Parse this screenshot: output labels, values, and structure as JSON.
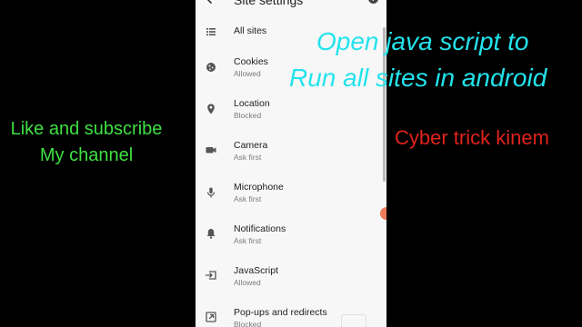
{
  "overlay": {
    "title_line1": "Open java script to",
    "title_line2": "Run all sites in android",
    "left_line1": "Like and subscribe",
    "left_line2": "My channel",
    "right_text": "Cyber trick kinem"
  },
  "screen": {
    "title": "Site settings",
    "help_glyph": "?"
  },
  "settings": [
    {
      "title": "All sites",
      "subtitle": "",
      "icon": "list-icon"
    },
    {
      "title": "Cookies",
      "subtitle": "Allowed",
      "icon": "cookie-icon"
    },
    {
      "title": "Location",
      "subtitle": "Blocked",
      "icon": "location-pin-icon"
    },
    {
      "title": "Camera",
      "subtitle": "Ask first",
      "icon": "camera-icon"
    },
    {
      "title": "Microphone",
      "subtitle": "Ask first",
      "icon": "microphone-icon"
    },
    {
      "title": "Notifications",
      "subtitle": "Ask first",
      "icon": "bell-icon"
    },
    {
      "title": "JavaScript",
      "subtitle": "Allowed",
      "icon": "javascript-icon"
    },
    {
      "title": "Pop-ups and redirects",
      "subtitle": "Blocked",
      "icon": "popup-icon"
    }
  ],
  "colors": {
    "title_caption": "#23e3ec",
    "left_caption": "#3ee043",
    "right_caption": "#e0231c",
    "panel_bg": "#f7f7f7"
  }
}
